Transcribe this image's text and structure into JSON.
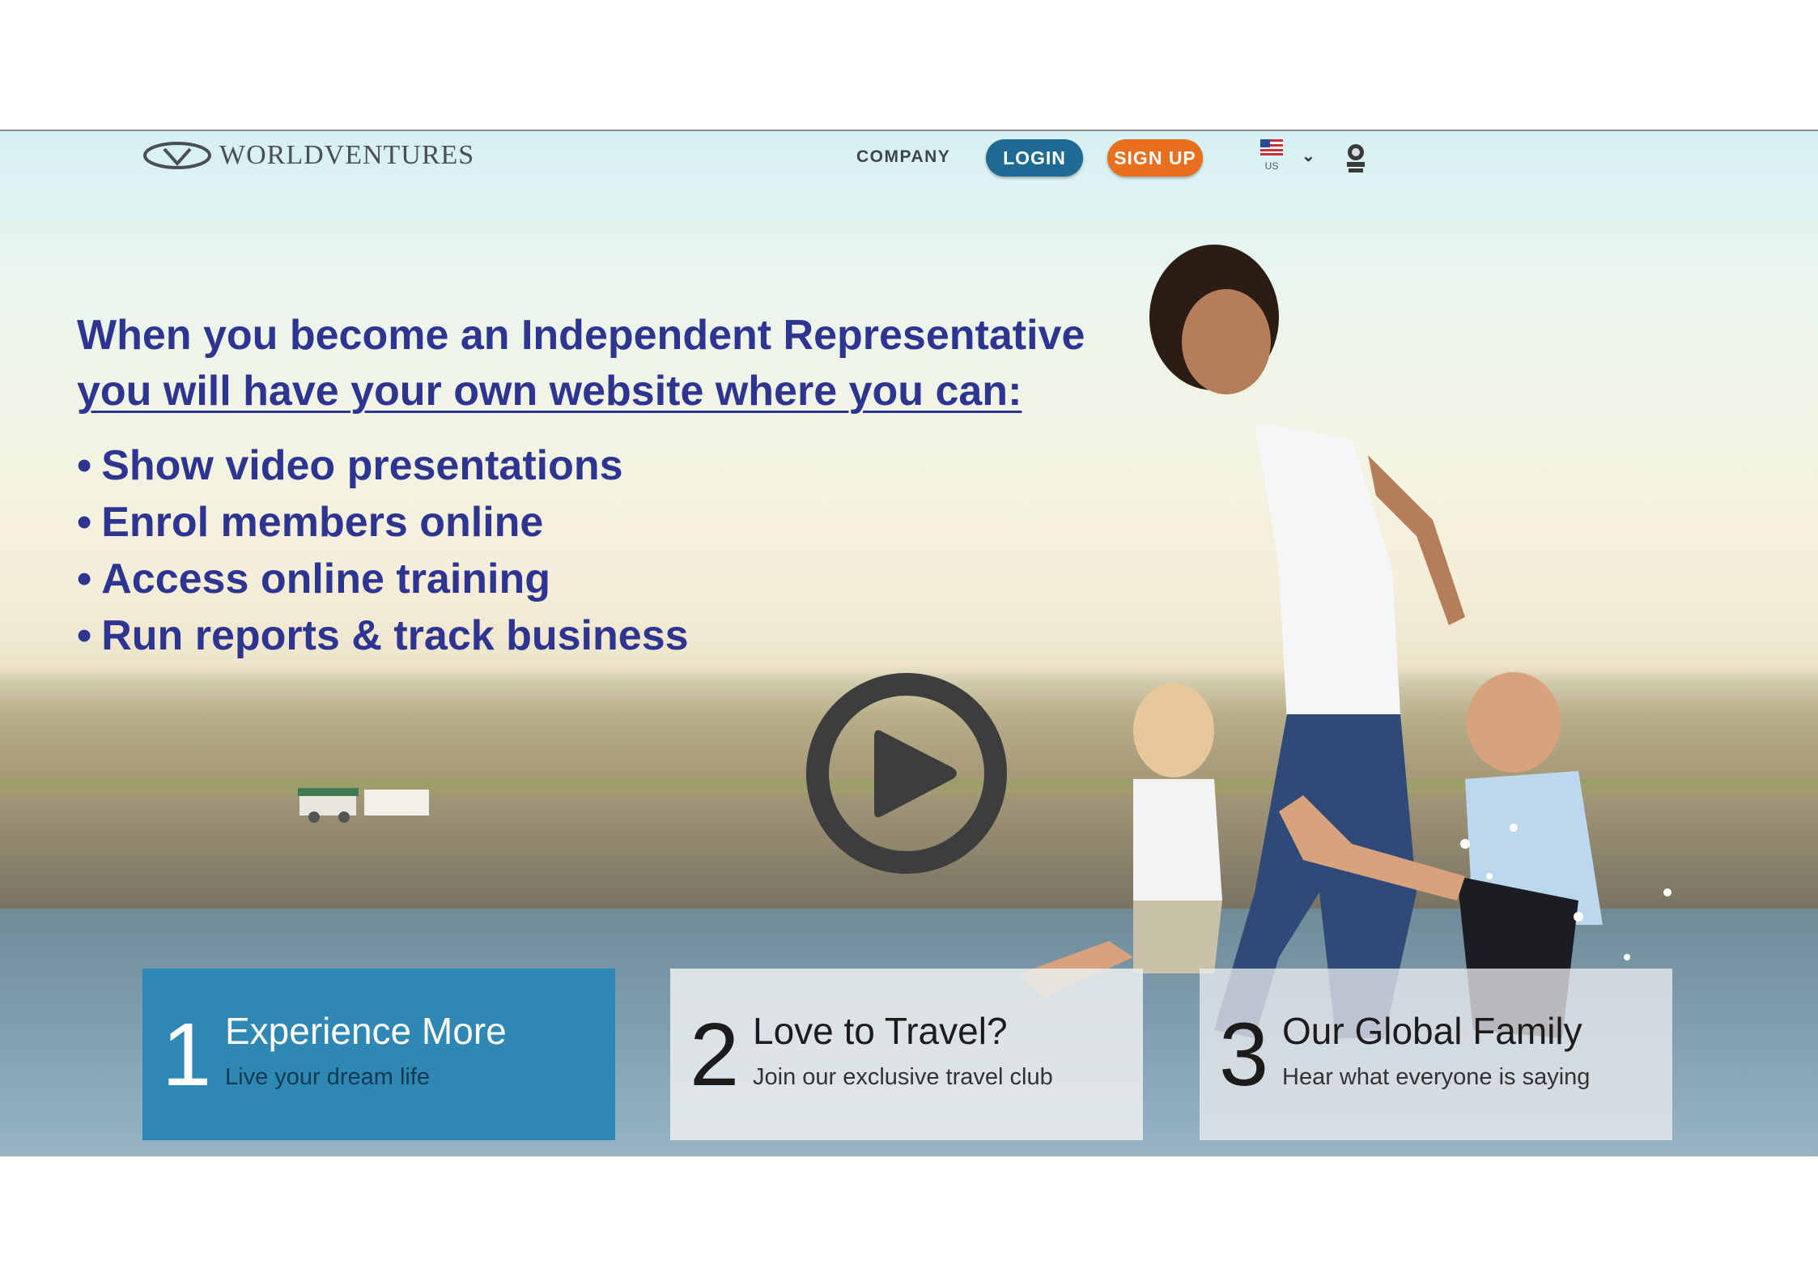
{
  "header": {
    "logo_text": "WORLDVENTURES",
    "nav_company": "COMPANY",
    "login_label": "LOGIN",
    "signup_label": "SIGN UP",
    "country_label": "US",
    "country_flag_icon": "us-flag-icon",
    "dropdown_icon": "chevron-down-icon",
    "badge_icon": "travel-badge-icon"
  },
  "overlay": {
    "headline_line1": "When you become an Independent Representative",
    "headline_line2": "you will have your own website where you can:",
    "bullets": [
      "Show video presentations",
      "Enrol members online",
      "Access online training",
      "Run reports & track business"
    ]
  },
  "video": {
    "icon": "play-icon"
  },
  "cards": [
    {
      "number": "1",
      "title": "Experience More",
      "subtitle": "Live your dream life"
    },
    {
      "number": "2",
      "title": "Love to Travel?",
      "subtitle": "Join our exclusive travel club"
    },
    {
      "number": "3",
      "title": "Our Global Family",
      "subtitle": "Hear what everyone is saying"
    }
  ],
  "colors": {
    "headline": "#2e3590",
    "login_button": "#1f6a95",
    "signup_button": "#e86f1d",
    "card_primary": "#2f87b3"
  }
}
